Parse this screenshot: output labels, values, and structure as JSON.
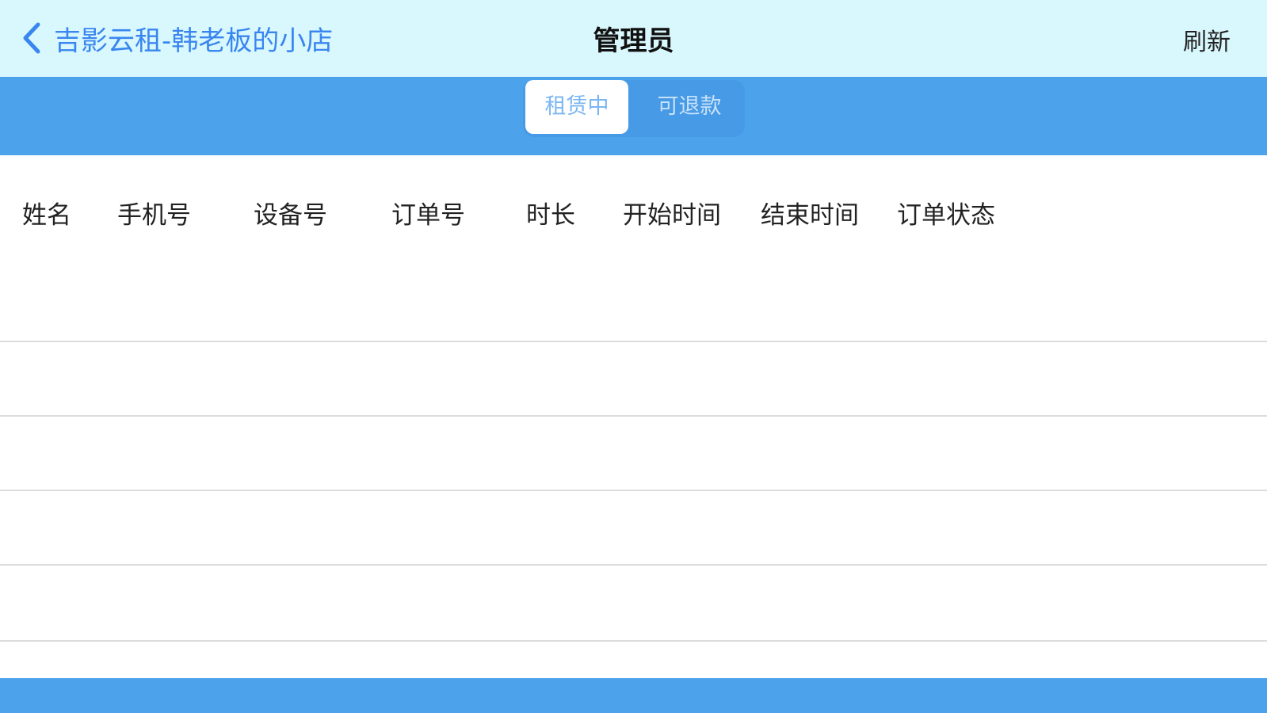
{
  "navbar": {
    "back_label": "吉影云租-韩老板的小店",
    "title": "管理员",
    "refresh_label": "刷新"
  },
  "tabs": [
    {
      "label": "租赁中",
      "active": true
    },
    {
      "label": "可退款",
      "active": false
    }
  ],
  "table": {
    "columns": [
      "姓名",
      "手机号",
      "设备号",
      "订单号",
      "时长",
      "开始时间",
      "结束时间",
      "订单状态"
    ],
    "rows": []
  },
  "colors": {
    "navbar_bg": "#d9f8fd",
    "accent_blue": "#4da3eb",
    "link_blue": "#3a86f0"
  },
  "icons": {
    "back": "chevron-left-icon"
  }
}
